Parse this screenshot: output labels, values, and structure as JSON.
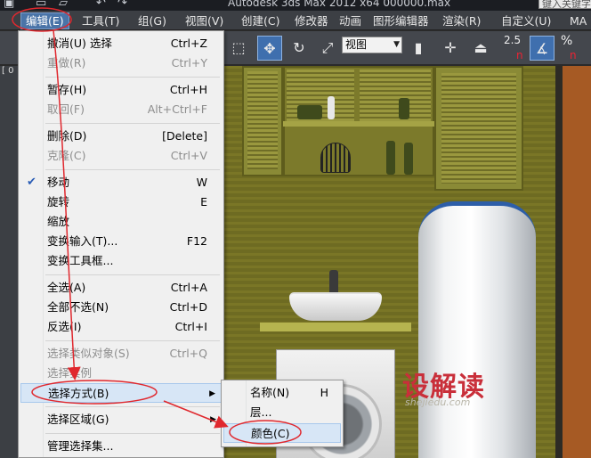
{
  "titlebar": {
    "title": "Autodesk 3ds Max  2012 x64       000000.max",
    "search_placeholder": "键入关键字"
  },
  "menubar": {
    "items": [
      "编辑(E)",
      "工具(T)",
      "组(G)",
      "视图(V)",
      "创建(C)",
      "修改器",
      "动画",
      "图形编辑器",
      "渲染(R)",
      "自定义(U)",
      "MA"
    ]
  },
  "toolbar": {
    "view_select": "视图",
    "snap_label": "2.5",
    "percent_label": "%",
    "n_label": "n"
  },
  "leftstrip": {
    "text": "[ 0"
  },
  "edit_menu": {
    "items": [
      {
        "label": "撤消(U) 选择",
        "shortcut": "Ctrl+Z",
        "disabled": false
      },
      {
        "label": "重做(R)",
        "shortcut": "Ctrl+Y",
        "disabled": true
      },
      {
        "label": "暂存(H)",
        "shortcut": "Ctrl+H",
        "disabled": false
      },
      {
        "label": "取回(F)",
        "shortcut": "Alt+Ctrl+F",
        "disabled": true
      },
      {
        "label": "删除(D)",
        "shortcut": "[Delete]",
        "disabled": false
      },
      {
        "label": "克隆(C)",
        "shortcut": "Ctrl+V",
        "disabled": true
      },
      {
        "label": "移动",
        "shortcut": "W",
        "disabled": false,
        "checked": true
      },
      {
        "label": "旋转",
        "shortcut": "E",
        "disabled": false
      },
      {
        "label": "缩放",
        "shortcut": "",
        "disabled": false
      },
      {
        "label": "变换输入(T)...",
        "shortcut": "F12",
        "disabled": false
      },
      {
        "label": "变换工具框...",
        "shortcut": "",
        "disabled": false
      },
      {
        "label": "全选(A)",
        "shortcut": "Ctrl+A",
        "disabled": false
      },
      {
        "label": "全部不选(N)",
        "shortcut": "Ctrl+D",
        "disabled": false
      },
      {
        "label": "反选(I)",
        "shortcut": "Ctrl+I",
        "disabled": false
      },
      {
        "label": "选择类似对象(S)",
        "shortcut": "Ctrl+Q",
        "disabled": true
      },
      {
        "label": "选择实例",
        "shortcut": "",
        "disabled": true
      },
      {
        "label": "选择方式(B)",
        "shortcut": "",
        "disabled": false,
        "submenu": true
      },
      {
        "label": "选择区域(G)",
        "shortcut": "",
        "disabled": false,
        "submenu": true
      },
      {
        "label": "管理选择集...",
        "shortcut": "",
        "disabled": false
      }
    ],
    "check_mark": "✔"
  },
  "select_by_submenu": {
    "items": [
      {
        "label": "名称(N)",
        "shortcut": "H"
      },
      {
        "label": "层...",
        "shortcut": ""
      },
      {
        "label": "颜色(C)",
        "shortcut": ""
      }
    ]
  },
  "watermark": {
    "main": "设解读",
    "sub": "shejiedu.com"
  },
  "colors": {
    "menu_highlight": "#d7e6f6",
    "annotation_red": "#e0282e",
    "accent_blue": "#3f6fae"
  }
}
